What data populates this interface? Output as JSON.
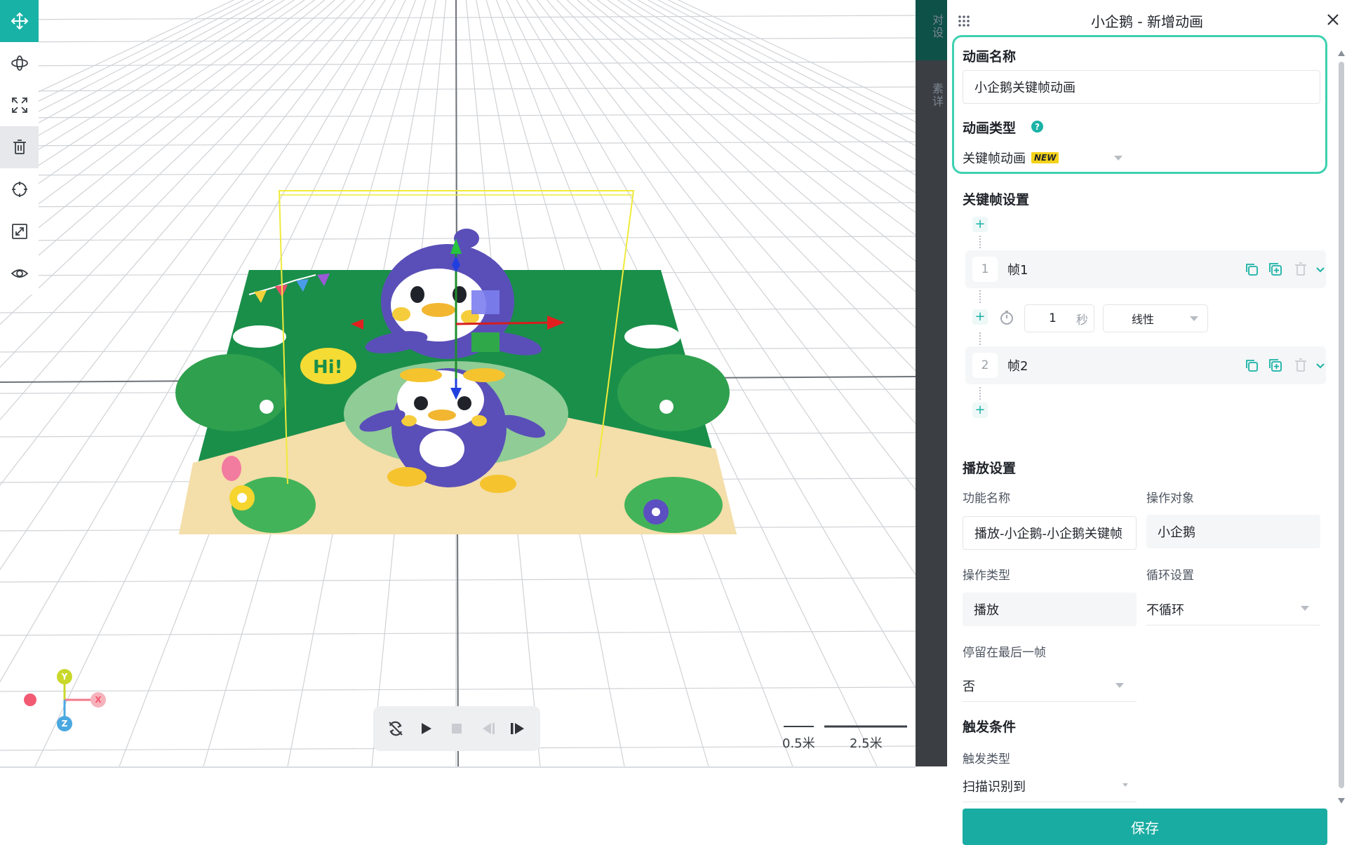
{
  "viewport": {
    "tools": [
      {
        "name": "move-tool",
        "icon": "move-arrows-icon",
        "active": true
      },
      {
        "name": "rotate-tool",
        "icon": "rotate-orbit-icon",
        "active": false
      },
      {
        "name": "scale-tool",
        "icon": "expand-corners-icon",
        "active": false
      },
      {
        "name": "delete-tool",
        "icon": "trash-icon",
        "active": false
      },
      {
        "name": "focus-tool",
        "icon": "crosshair-icon",
        "active": false
      },
      {
        "name": "fit-tool",
        "icon": "shrink-frame-icon",
        "active": false
      },
      {
        "name": "visibility-tool",
        "icon": "eye-icon",
        "active": false
      }
    ],
    "axes": {
      "x": "X",
      "y": "Y",
      "z": "Z"
    },
    "scale": {
      "small": "0.5米",
      "large": "2.5米"
    },
    "playback": [
      "loop-off-icon",
      "play-icon",
      "stop-icon",
      "step-back-icon",
      "step-forward-icon"
    ],
    "strip_text": {
      "top": "对\n设",
      "mid": "素\n详"
    }
  },
  "panel": {
    "title": "小企鹅 - 新增动画",
    "basic": {
      "name_label": "动画名称",
      "name_value": "小企鹅关键帧动画",
      "type_label": "动画类型",
      "type_help": "?",
      "type_value": "关键帧动画",
      "type_badge": "NEW"
    },
    "keyframes": {
      "section_title": "关键帧设置",
      "add": "+",
      "frames": [
        {
          "index": "1",
          "name": "帧1"
        },
        {
          "index": "2",
          "name": "帧2"
        }
      ],
      "transition": {
        "duration": "1",
        "unit": "秒",
        "easing": "线性"
      }
    },
    "playback": {
      "section_title": "播放设置",
      "func_name_label": "功能名称",
      "func_name_value": "播放-小企鹅-小企鹅关键帧",
      "target_label": "操作对象",
      "target_value": "小企鹅",
      "op_type_label": "操作类型",
      "op_type_value": "播放",
      "loop_label": "循环设置",
      "loop_value": "不循环",
      "hold_label": "停留在最后一帧",
      "hold_value": "否"
    },
    "trigger": {
      "section_title": "触发条件",
      "type_label": "触发类型",
      "type_value": "扫描识别到"
    },
    "save_label": "保存"
  },
  "colors": {
    "accent": "#19b2a6",
    "highlight_border": "#3ed1b0",
    "badge": "#f3d21a",
    "axis_x": "#f27a8a",
    "axis_y": "#c9d82a",
    "axis_z": "#4aa8e0"
  }
}
